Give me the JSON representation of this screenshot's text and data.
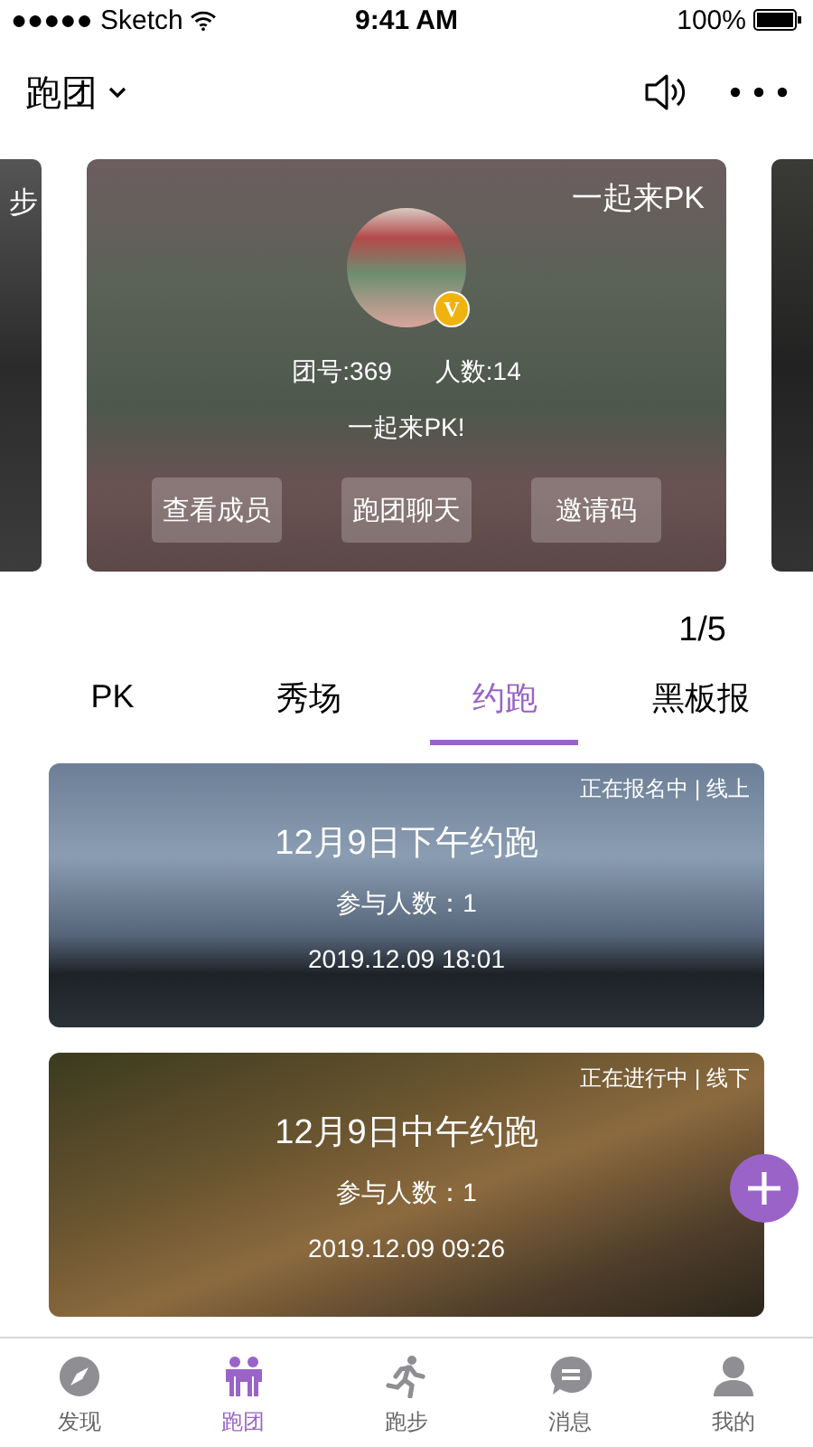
{
  "status_bar": {
    "carrier": "●●●●● Sketch",
    "time": "9:41 AM",
    "battery": "100%"
  },
  "header": {
    "title": "跑团"
  },
  "carousel": [
    {
      "kind": "peek",
      "label": "步"
    },
    {
      "kind": "main",
      "tag": "一起来PK",
      "badge": "V",
      "team_no": "团号:369",
      "members": "人数:14",
      "motto": "一起来PK!",
      "buttons": [
        "查看成员",
        "跑团聊天",
        "邀请码"
      ]
    },
    {
      "kind": "peek"
    }
  ],
  "pager": "1/5",
  "tabs": [
    {
      "label": "PK",
      "selected": false
    },
    {
      "label": "秀场",
      "selected": false
    },
    {
      "label": "约跑",
      "selected": true
    },
    {
      "label": "黑板报",
      "selected": false
    }
  ],
  "events": [
    {
      "status": "正在报名中 | 线上",
      "title": "12月9日下午约跑",
      "participants": "参与人数：1",
      "time": "2019.12.09 18:01"
    },
    {
      "status": "正在进行中 | 线下",
      "title": "12月9日中午约跑",
      "participants": "参与人数：1",
      "time": "2019.12.09 09:26"
    }
  ],
  "tab_bar": [
    {
      "label": "发现",
      "selected": false
    },
    {
      "label": "跑团",
      "selected": true
    },
    {
      "label": "跑步",
      "selected": false
    },
    {
      "label": "消息",
      "selected": false
    },
    {
      "label": "我的",
      "selected": false
    }
  ]
}
